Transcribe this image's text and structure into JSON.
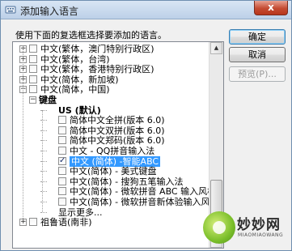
{
  "window": {
    "title": "添加输入语言",
    "close_label": "x"
  },
  "instruction": "使用下面的复选框选择要添加的语言。",
  "tree": {
    "rows": [
      {
        "text": "中文(繁体，澳门特别行政区)",
        "expander": "+",
        "checkbox": true,
        "checked": false,
        "level": 0
      },
      {
        "text": "中文(繁体，台湾)",
        "expander": "+",
        "checkbox": true,
        "checked": false,
        "level": 0
      },
      {
        "text": "中文(繁体，香港特别行政区)",
        "expander": "+",
        "checkbox": true,
        "checked": false,
        "level": 0
      },
      {
        "text": "中文(简体，新加坡)",
        "expander": "+",
        "checkbox": true,
        "checked": false,
        "level": 0
      },
      {
        "text": "中文(简体，中国)",
        "expander": "−",
        "checkbox": true,
        "checked": false,
        "level": 0
      },
      {
        "text": "键盘",
        "expander": "−",
        "checkbox": false,
        "checked": false,
        "level": 1
      },
      {
        "text": "US (默认)",
        "expander": "",
        "checkbox": false,
        "checked": false,
        "level": 2
      },
      {
        "text": "简体中文全拼(版本 6.0)",
        "expander": "",
        "checkbox": true,
        "checked": false,
        "level": 2
      },
      {
        "text": "简体中文双拼(版本 6.0)",
        "expander": "",
        "checkbox": true,
        "checked": false,
        "level": 2
      },
      {
        "text": "简体中文郑码(版本 6.0)",
        "expander": "",
        "checkbox": true,
        "checked": false,
        "level": 2
      },
      {
        "text": "中文 - QQ拼音输入法",
        "expander": "",
        "checkbox": true,
        "checked": false,
        "level": 2
      },
      {
        "text": "中文 (简体) -智能ABC",
        "expander": "",
        "checkbox": true,
        "checked": true,
        "level": 2,
        "selected": true
      },
      {
        "text": "中文(简体) - 美式键盘",
        "expander": "",
        "checkbox": true,
        "checked": false,
        "level": 2
      },
      {
        "text": "中文(简体) - 搜狗五笔输入法",
        "expander": "",
        "checkbox": true,
        "checked": false,
        "level": 2
      },
      {
        "text": "中文(简体) - 微软拼音 ABC 输入风格",
        "expander": "",
        "checkbox": true,
        "checked": false,
        "level": 2
      },
      {
        "text": "中文(简体) - 微软拼音新体验输入风格",
        "expander": "",
        "checkbox": true,
        "checked": false,
        "level": 2
      },
      {
        "text": "显示更多...",
        "expander": "",
        "checkbox": false,
        "checked": false,
        "level": 2
      },
      {
        "text": "祖鲁语(南非)",
        "expander": "+",
        "checkbox": true,
        "checked": false,
        "level": 0
      }
    ]
  },
  "buttons": {
    "ok": "确定",
    "cancel": "取消",
    "preview": "预览(P)..."
  },
  "watermark": {
    "name": "妙妙网",
    "sub": "MIAOMIAOWANG"
  },
  "colors": {
    "selection": "#3399ff",
    "titlebar": "#bcd0e8"
  }
}
